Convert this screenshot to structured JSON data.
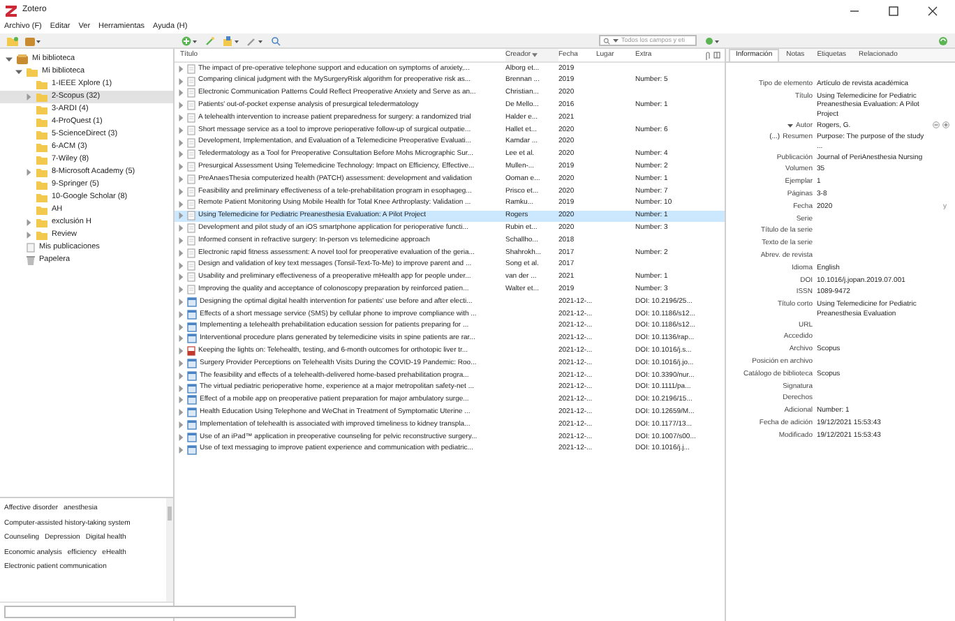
{
  "window": {
    "title": "Zotero"
  },
  "menu": [
    "Archivo (F)",
    "Editar",
    "Ver",
    "Herramientas",
    "Ayuda (H)"
  ],
  "search": {
    "placeholder": "Todos los campos y eti"
  },
  "collections": [
    {
      "label": "Mi biblioteca",
      "kind": "library",
      "expanded": true,
      "selected": false,
      "children": [
        {
          "label": "Mi biblioteca",
          "kind": "folder",
          "expanded": true,
          "selected": false,
          "children": [
            {
              "label": "1-IEEE Xplore (1)",
              "kind": "folder",
              "selected": false
            },
            {
              "label": "2-Scopus (32)",
              "kind": "folder",
              "expanded": false,
              "selected": true
            },
            {
              "label": "3-ARDI (4)",
              "kind": "folder",
              "selected": false
            },
            {
              "label": "4-ProQuest (1)",
              "kind": "folder",
              "selected": false
            },
            {
              "label": "5-ScienceDirect (3)",
              "kind": "folder",
              "selected": false
            },
            {
              "label": "6-ACM (3)",
              "kind": "folder",
              "selected": false
            },
            {
              "label": "7-Wiley (8)",
              "kind": "folder",
              "selected": false
            },
            {
              "label": "8-Microsoft Academy (5)",
              "kind": "folder",
              "expanded": false,
              "selected": false
            },
            {
              "label": "9-Springer (5)",
              "kind": "folder",
              "selected": false
            },
            {
              "label": "10-Google Scholar (8)",
              "kind": "folder",
              "selected": false
            },
            {
              "label": "AH",
              "kind": "folder",
              "selected": false
            },
            {
              "label": "exclusión H",
              "kind": "folder",
              "expanded": false,
              "selected": false
            },
            {
              "label": "Review",
              "kind": "folder",
              "expanded": false,
              "selected": false
            }
          ]
        },
        {
          "label": "Mis publicaciones",
          "kind": "publications",
          "selected": false
        },
        {
          "label": "Papelera",
          "kind": "trash",
          "selected": false
        }
      ]
    }
  ],
  "tags": [
    "Affective disorder",
    "anesthesia",
    "Computer-assisted history-taking system",
    "Counseling",
    "Depression",
    "Digital health",
    "Economic analysis",
    "efficiency",
    "eHealth",
    "Electronic patient communication"
  ],
  "columns": [
    {
      "label": "Título",
      "sorted": false
    },
    {
      "label": "Creador",
      "sorted": true
    },
    {
      "label": "Fecha",
      "sorted": false
    },
    {
      "label": "Lugar",
      "sorted": false
    },
    {
      "label": "Extra",
      "sorted": false
    }
  ],
  "rows": [
    {
      "kind": "article",
      "title": "The impact of pre-operative telephone support and education on symptoms of anxiety,...",
      "creator": "Alborg et...",
      "date": "2019",
      "selected": false
    },
    {
      "kind": "article",
      "title": "Comparing clinical judgment with the MySurgeryRisk algorithm for preoperative risk as...",
      "creator": "Brennan ...",
      "date": "2019",
      "extra": "Number: 5",
      "selected": false
    },
    {
      "kind": "article",
      "title": "Electronic Communication Patterns Could Reflect Preoperative Anxiety and Serve as an...",
      "creator": "Christian...",
      "date": "2020",
      "selected": false
    },
    {
      "kind": "article",
      "title": "Patients' out-of-pocket expense analysis of presurgical teledermatology",
      "creator": "De Mello...",
      "date": "2016",
      "extra": "Number: 1",
      "selected": false
    },
    {
      "kind": "article",
      "title": "A telehealth intervention to increase patient preparedness for surgery: a randomized trial",
      "creator": "Halder e...",
      "date": "2021",
      "selected": false
    },
    {
      "kind": "article",
      "title": "Short message service as a tool to improve perioperative follow-up of surgical outpatie...",
      "creator": "Hallet et...",
      "date": "2020",
      "extra": "Number: 6",
      "selected": false
    },
    {
      "kind": "article",
      "title": "Development, Implementation, and Evaluation of a Telemedicine Preoperative Evaluati...",
      "creator": "Kamdar ...",
      "date": "2020",
      "selected": false
    },
    {
      "kind": "article",
      "title": "Teledermatology as a Tool for Preoperative Consultation Before Mohs Micrographic Sur...",
      "creator": "Lee et al.",
      "date": "2020",
      "extra": "Number: 4",
      "selected": false
    },
    {
      "kind": "article",
      "title": "Presurgical Assessment Using Telemedicine Technology: Impact on Efficiency, Effective...",
      "creator": "Mullen-...",
      "date": "2019",
      "extra": "Number: 2",
      "selected": false
    },
    {
      "kind": "article",
      "title": "PreAnaesThesia computerized health (PATCH) assessment: development and validation",
      "creator": "Ooman e...",
      "date": "2020",
      "extra": "Number: 1",
      "selected": false
    },
    {
      "kind": "article",
      "title": "Feasibility and preliminary effectiveness of a tele-prehabilitation program in esophageg...",
      "creator": "Prisco et...",
      "date": "2020",
      "extra": "Number: 7",
      "selected": false
    },
    {
      "kind": "article",
      "title": "Remote Patient Monitoring Using Mobile Health for Total Knee Arthroplasty: Validation ...",
      "creator": "Ramku...",
      "date": "2019",
      "extra": "Number: 10",
      "selected": false
    },
    {
      "kind": "article",
      "title": "Using Telemedicine for Pediatric Preanesthesia Evaluation: A Pilot Project",
      "creator": "Rogers",
      "date": "2020",
      "extra": "Number: 1",
      "selected": true
    },
    {
      "kind": "article",
      "title": "Development and pilot study of an iOS smartphone application for perioperative functi...",
      "creator": "Rubin et...",
      "date": "2020",
      "extra": "Number: 3",
      "selected": false
    },
    {
      "kind": "article",
      "title": "Informed consent in refractive surgery: In-person vs telemedicine approach",
      "creator": "Schallho...",
      "date": "2018",
      "selected": false
    },
    {
      "kind": "article",
      "title": "Electronic rapid fitness assessment: A novel tool for preoperative evaluation of the geria...",
      "creator": "Shahrokh...",
      "date": "2017",
      "extra": "Number: 2",
      "selected": false
    },
    {
      "kind": "article",
      "title": "Design and validation of key text messages (Tonsil-Text-To-Me) to improve parent and ...",
      "creator": "Song et al.",
      "date": "2017",
      "selected": false
    },
    {
      "kind": "article",
      "title": "Usability and preliminary effectiveness of a preoperative mHealth app for people under...",
      "creator": "van der ...",
      "date": "2021",
      "extra": "Number: 1",
      "selected": false
    },
    {
      "kind": "article",
      "title": "Improving the quality and acceptance of colonoscopy preparation by reinforced patien...",
      "creator": "Walter et...",
      "date": "2019",
      "extra": "Number: 3",
      "selected": false
    },
    {
      "kind": "webpage",
      "title": "Designing the optimal digital health intervention for patients' use before and after electi...",
      "date": "2021-12-...",
      "extra": "DOI: 10.2196/25...",
      "selected": false
    },
    {
      "kind": "webpage",
      "title": "Effects of a short message service (SMS) by cellular phone to improve compliance with ...",
      "date": "2021-12-...",
      "extra": "DOI: 10.1186/s12...",
      "selected": false
    },
    {
      "kind": "webpage",
      "title": "Implementing a telehealth prehabilitation education session for patients preparing for ...",
      "date": "2021-12-...",
      "extra": "DOI: 10.1186/s12...",
      "selected": false
    },
    {
      "kind": "webpage",
      "title": "Interventional procedure plans generated by telemedicine visits in spine patients are rar...",
      "date": "2021-12-...",
      "extra": "DOI: 10.1136/rap...",
      "selected": false
    },
    {
      "kind": "pdf",
      "title": "Keeping the lights on: Telehealth, testing, and 6-month outcomes for orthotopic liver tr...",
      "date": "2021-12-...",
      "extra": "DOI: 10.1016/j.s...",
      "selected": false
    },
    {
      "kind": "webpage",
      "title": "Surgery Provider Perceptions on Telehealth Visits During the COVID-19 Pandemic: Roo...",
      "date": "2021-12-...",
      "extra": "DOI: 10.1016/j.jo...",
      "selected": false
    },
    {
      "kind": "webpage",
      "title": "The feasibility and effects of a telehealth-delivered home-based prehabilitation progra...",
      "date": "2021-12-...",
      "extra": "DOI: 10.3390/nur...",
      "selected": false
    },
    {
      "kind": "webpage",
      "title": "The virtual pediatric perioperative home, experience at a major metropolitan safety-net ...",
      "date": "2021-12-...",
      "extra": "DOI: 10.1111/pa...",
      "selected": false
    },
    {
      "kind": "webpage",
      "title": "Effect of a mobile app on preoperative patient preparation for major ambulatory surge...",
      "date": "2021-12-...",
      "extra": "DOI: 10.2196/15...",
      "selected": false
    },
    {
      "kind": "webpage",
      "title": "Health Education Using Telephone and WeChat in Treatment of Symptomatic Uterine ...",
      "date": "2021-12-...",
      "extra": "DOI: 10.12659/M...",
      "selected": false
    },
    {
      "kind": "webpage",
      "title": "Implementation of telehealth is associated with improved timeliness to kidney transpla...",
      "date": "2021-12-...",
      "extra": "DOI: 10.1177/13...",
      "selected": false
    },
    {
      "kind": "webpage",
      "title": "Use of an iPad™ application in preoperative counseling for pelvic reconstructive surgery...",
      "date": "2021-12-...",
      "extra": "DOI: 10.1007/s00...",
      "selected": false
    },
    {
      "kind": "webpage",
      "title": "Use of text messaging to improve patient experience and communication with pediatric...",
      "date": "2021-12-...",
      "extra": "DOI: 10.1016/j.j...",
      "selected": false
    }
  ],
  "info": {
    "tabs": [
      {
        "label": "Información",
        "selected": true
      },
      {
        "label": "Notas",
        "selected": false
      },
      {
        "label": "Etiquetas",
        "selected": false
      },
      {
        "label": "Relacionado",
        "selected": false
      }
    ],
    "fields": [
      {
        "kind": "plain",
        "label": "Tipo de elemento",
        "value": "Artículo de revista académica"
      },
      {
        "kind": "plain",
        "label": "Título",
        "value": "Using Telemedicine for Pediatric Preanesthesia Evaluation: A Pilot Project"
      },
      {
        "kind": "creator",
        "label": "Autor",
        "value": "Rogers, G."
      },
      {
        "kind": "toggle",
        "toggle": "(...)",
        "label": "Resumen",
        "value": "Purpose: The purpose of the study ..."
      },
      {
        "kind": "plain",
        "label": "Publicación",
        "value": "Journal of PeriAnesthesia Nursing"
      },
      {
        "kind": "plain",
        "label": "Volumen",
        "value": "35"
      },
      {
        "kind": "plain",
        "label": "Ejemplar",
        "value": "1"
      },
      {
        "kind": "plain",
        "label": "Páginas",
        "value": "3-8"
      },
      {
        "kind": "date",
        "label": "Fecha",
        "value": "2020",
        "hint": "y"
      },
      {
        "kind": "plain",
        "label": "Serie"
      },
      {
        "kind": "plain",
        "label": "Título de la serie"
      },
      {
        "kind": "plain",
        "label": "Texto de la serie"
      },
      {
        "kind": "plain",
        "label": "Abrev. de revista"
      },
      {
        "kind": "plain",
        "label": "Idioma",
        "value": "English"
      },
      {
        "kind": "plain",
        "label": "DOI",
        "value": "10.1016/j.jopan.2019.07.001"
      },
      {
        "kind": "plain",
        "label": "ISSN",
        "value": "1089-9472"
      },
      {
        "kind": "plain",
        "label": "Título corto",
        "value": "Using Telemedicine for Pediatric Preanesthesia Evaluation"
      },
      {
        "kind": "plain",
        "label": "URL"
      },
      {
        "kind": "plain",
        "label": "Accedido"
      },
      {
        "kind": "plain",
        "label": "Archivo",
        "value": "Scopus"
      },
      {
        "kind": "plain",
        "label": "Posición en archivo"
      },
      {
        "kind": "plain",
        "label": "Catálogo de biblioteca",
        "value": "Scopus"
      },
      {
        "kind": "plain",
        "label": "Signatura"
      },
      {
        "kind": "plain",
        "label": "Derechos"
      },
      {
        "kind": "plain",
        "label": "Adicional",
        "value": "Number: 1"
      },
      {
        "kind": "plain",
        "label": "Fecha de adición",
        "value": "19/12/2021 15:53:43"
      },
      {
        "kind": "plain",
        "label": "Modificado",
        "value": "19/12/2021 15:53:43"
      }
    ]
  }
}
